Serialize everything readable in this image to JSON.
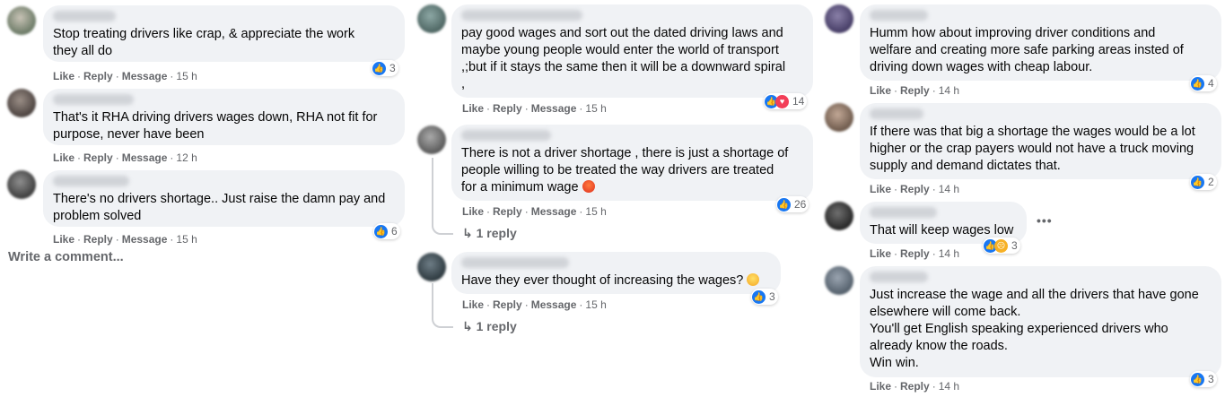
{
  "actions": {
    "like": "Like",
    "reply": "Reply",
    "message": "Message",
    "sep": "·"
  },
  "write_comment": "Write a comment...",
  "column1": [
    {
      "text": "Stop treating drivers like crap, & appreciate the work\nthey all do",
      "time": "15 h",
      "reaction_count": "3",
      "reactions": [
        "like"
      ]
    },
    {
      "text": "That's it RHA driving drivers wages down, RHA not fit for\npurpose, never have been",
      "time": "12 h",
      "reaction_count": "",
      "reactions": []
    },
    {
      "text": "There's no drivers shortage.. Just raise the damn pay and\nproblem solved",
      "time": "15 h",
      "reaction_count": "6",
      "reactions": [
        "like"
      ]
    }
  ],
  "column2": [
    {
      "text": "pay good wages and sort out the dated driving laws and\nmaybe young people would enter the world of transport\n,;but if it stays the same then it will be a downward spiral\n,",
      "time": "15 h",
      "reaction_count": "14",
      "reactions": [
        "like",
        "love"
      ]
    },
    {
      "text": "There is not a driver shortage , there is just a shortage of\npeople willing to be treated the way drivers are treated\nfor a minimum wage",
      "emoji": "angry",
      "time": "15 h",
      "reaction_count": "26",
      "reactions": [
        "like"
      ],
      "reply_text": "1 reply"
    },
    {
      "text": "Have they ever thought of increasing the wages?",
      "emoji": "laugh",
      "time": "15 h",
      "reaction_count": "3",
      "reactions": [
        "like"
      ],
      "reply_text": "1 reply"
    }
  ],
  "column3": [
    {
      "text": "Humm how about improving driver conditions and\nwelfare and creating more safe parking areas insted of\ndriving down wages with cheap labour.",
      "time": "14 h",
      "reaction_count": "4",
      "reactions": [
        "like"
      ]
    },
    {
      "text": "If there was that big a shortage the wages would be a lot\nhigher or the crap payers would not have a truck moving\nsupply and demand dictates that.",
      "time": "14 h",
      "reaction_count": "2",
      "reactions": [
        "like"
      ]
    },
    {
      "text": "That will keep wages low",
      "time": "14 h",
      "reaction_count": "3",
      "reactions": [
        "like",
        "sad"
      ],
      "more": "•••"
    },
    {
      "text": "Just increase the wage and all the drivers that have gone\nelsewhere will come back.\nYou'll get English speaking experienced drivers who\nalready know the roads.\nWin win.",
      "time": "14 h",
      "reaction_count": "3",
      "reactions": [
        "like"
      ]
    }
  ]
}
